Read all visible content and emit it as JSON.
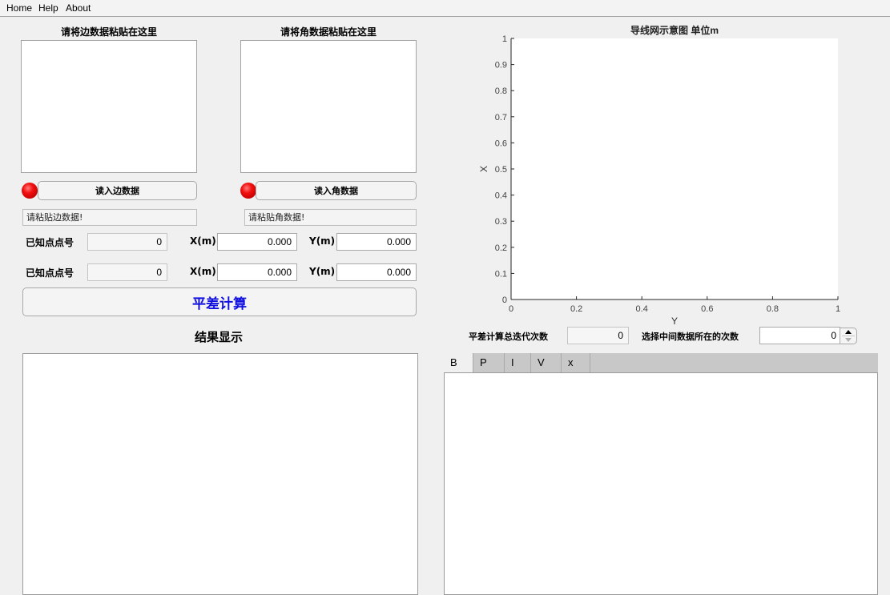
{
  "menu": {
    "items": [
      "Home",
      "Help",
      "About"
    ]
  },
  "edge_input": {
    "title": "请将边数据粘贴在这里",
    "value": "",
    "read_button": "读入边数据",
    "status_text": "请粘贴边数据!",
    "led_color": "#e00000"
  },
  "angle_input": {
    "title": "请将角数据粘贴在这里",
    "value": "",
    "read_button": "读入角数据",
    "status_text": "请粘贴角数据!",
    "led_color": "#e00000"
  },
  "known_points": [
    {
      "label": "已知点点号",
      "id_value": "0",
      "x_label": "X(m)",
      "x_value": "0.000",
      "y_label": "Y(m)",
      "y_value": "0.000"
    },
    {
      "label": "已知点点号",
      "id_value": "0",
      "x_label": "X(m)",
      "x_value": "0.000",
      "y_label": "Y(m)",
      "y_value": "0.000"
    }
  ],
  "calc_button": {
    "label": "平差计算",
    "color": "#1010e0"
  },
  "results": {
    "title": "结果显示",
    "content": ""
  },
  "iterations": {
    "total_label": "平差计算总迭代次数",
    "total_value": "0",
    "select_label": "选择中间数据所在的次数",
    "select_value": "0"
  },
  "tabs": [
    {
      "label": "B",
      "active": true
    },
    {
      "label": "P",
      "active": false
    },
    {
      "label": "I",
      "active": false
    },
    {
      "label": "V",
      "active": false
    },
    {
      "label": "x",
      "active": false
    }
  ],
  "chart_data": {
    "type": "line",
    "title": "导线网示意图 单位m",
    "xlabel": "Y",
    "ylabel": "X",
    "xlim": [
      0,
      1
    ],
    "ylim": [
      0,
      1
    ],
    "xticks": [
      "0",
      "0.2",
      "0.4",
      "0.6",
      "0.8",
      "1"
    ],
    "yticks": [
      "0",
      "0.1",
      "0.2",
      "0.3",
      "0.4",
      "0.5",
      "0.6",
      "0.7",
      "0.8",
      "0.9",
      "1"
    ],
    "grid": false,
    "series": []
  }
}
